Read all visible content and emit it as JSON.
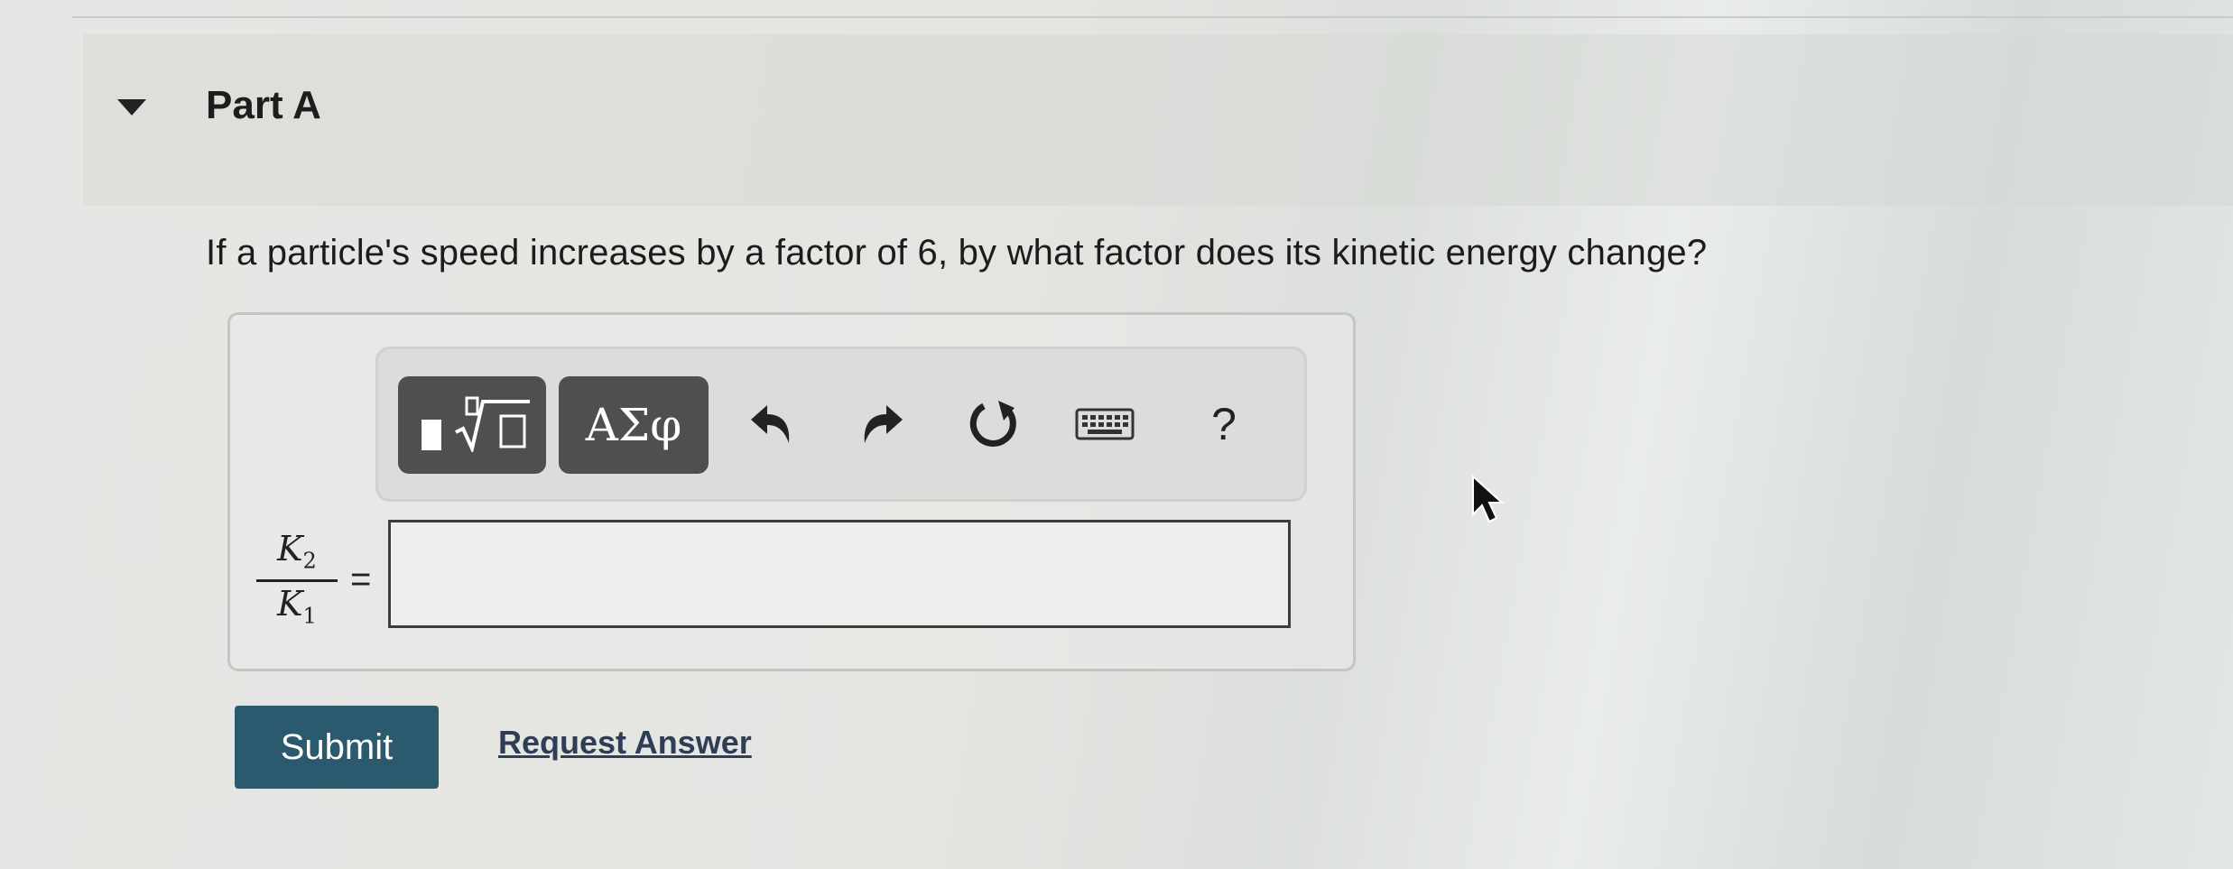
{
  "part": {
    "title": "Part A"
  },
  "question": {
    "text": "If a particle's speed increases by a factor of 6, by what factor does its kinetic energy change?"
  },
  "toolbar": {
    "template_icon": "templates-radical-icon",
    "greek_label": "ΑΣφ",
    "undo_icon": "undo-icon",
    "redo_icon": "redo-icon",
    "reset_icon": "reset-icon",
    "keyboard_icon": "keyboard-icon",
    "help_label": "?"
  },
  "answer": {
    "numerator": "K",
    "numerator_sub": "2",
    "denominator": "K",
    "denominator_sub": "1",
    "equals": "=",
    "input_value": ""
  },
  "actions": {
    "submit_label": "Submit",
    "request_label": "Request Answer"
  },
  "colors": {
    "submit_bg": "#2b5a6f",
    "toolbar_dark": "#4d4f50",
    "link": "#2f3d57"
  }
}
